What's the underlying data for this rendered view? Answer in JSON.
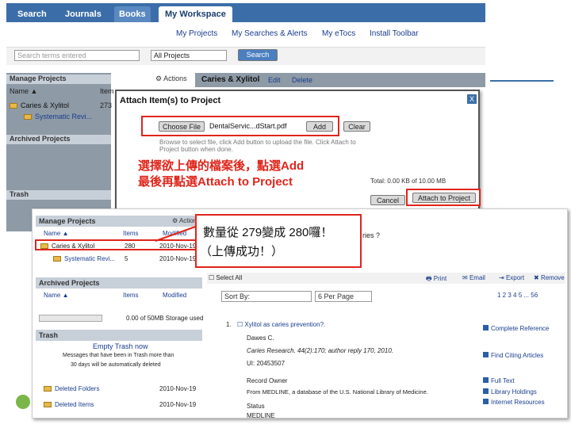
{
  "nav": {
    "tabs": [
      "Search",
      "Journals",
      "Books",
      "My Workspace"
    ],
    "active": "My Workspace"
  },
  "subnav": [
    "My Projects",
    "My Searches & Alerts",
    "My eTocs",
    "Install Toolbar"
  ],
  "search": {
    "placeholder": "Search terms entered",
    "select": "All Projects",
    "button": "Search"
  },
  "bg_left": {
    "manage": "Manage Projects",
    "actions": "Actions",
    "col_name": "Name ▲",
    "col_item": "Item",
    "folder1": "Caries & Xylitol",
    "folder1_items": "273",
    "folder2": "Systematic Revi...",
    "folder2_items": "5",
    "archived": "Archived Projects",
    "trash": "Trash"
  },
  "bg_header": {
    "title": "Caries & Xylitol",
    "edit": "Edit",
    "delete": "Delete"
  },
  "modal": {
    "title": "Attach Item(s) to Project",
    "close": "X",
    "choose_file": "Choose File",
    "filename": "DentalServic...dStart.pdf",
    "add": "Add",
    "clear": "Clear",
    "instructions": "Browse to select file, click Add button to upload the file. Click Attach to Project button when done.",
    "total": "Total: 0.00 KB of 10.00 MB",
    "cancel": "Cancel",
    "attach": "Attach to Project"
  },
  "note1": "選擇欲上傳的檔案後，點選Add",
  "note2": "最後再點選Attach to Project",
  "note3_line1": "數量從 279變成 280囉！",
  "note3_line2": "（上傳成功！）",
  "fg": {
    "manage": "Manage Projects",
    "actions": "Actions",
    "col_name": "Name ▲",
    "col_items": "Items",
    "col_modified": "Modified",
    "rows": [
      {
        "name": "Caries & Xylitol",
        "items": "280",
        "modified": "2010-Nov-19"
      },
      {
        "name": "Systematic Revi...",
        "items": "5",
        "modified": "2010-Nov-19"
      }
    ],
    "archived": "Archived Projects",
    "arch_name": "Name ▲",
    "arch_items": "Items",
    "arch_modified": "Modified",
    "storage": "0.00 of 50MB Storage used",
    "trash": "Trash",
    "empty_trash": "Empty Trash now",
    "trash_msg1": "Messages that have been in Trash more than",
    "trash_msg2": "30 days will be automatically deleted",
    "deleted_folders": "Deleted Folders",
    "deleted_folders_date": "2010-Nov-19",
    "deleted_items": "Deleted Items",
    "deleted_items_date": "2010-Nov-19",
    "question": "ries ?",
    "select_all": "Select All",
    "print": "Print",
    "email": "Email",
    "export": "Export",
    "remove": "Remove",
    "sort": "Sort By:",
    "per_page": "6 Per Page",
    "pages": "1 2 3 4 5 ... 56",
    "rec_num": "1.",
    "rec_title": "Xylitol as caries prevention?.",
    "rec_author": "Dawes C.",
    "rec_source": "Caries Research. 44(2):170; author reply 170, 2010.",
    "rec_ui": "UI: 20453507",
    "rec_owner_label": "Record Owner",
    "rec_owner": "From MEDLINE, a database of the U.S. National Library of Medicine.",
    "rec_status_label": "Status",
    "rec_status": "MEDLINE",
    "side_links": [
      "Complete Reference",
      "Find Citing Articles",
      "Full Text",
      "Library Holdings",
      "Internet Resources"
    ]
  }
}
